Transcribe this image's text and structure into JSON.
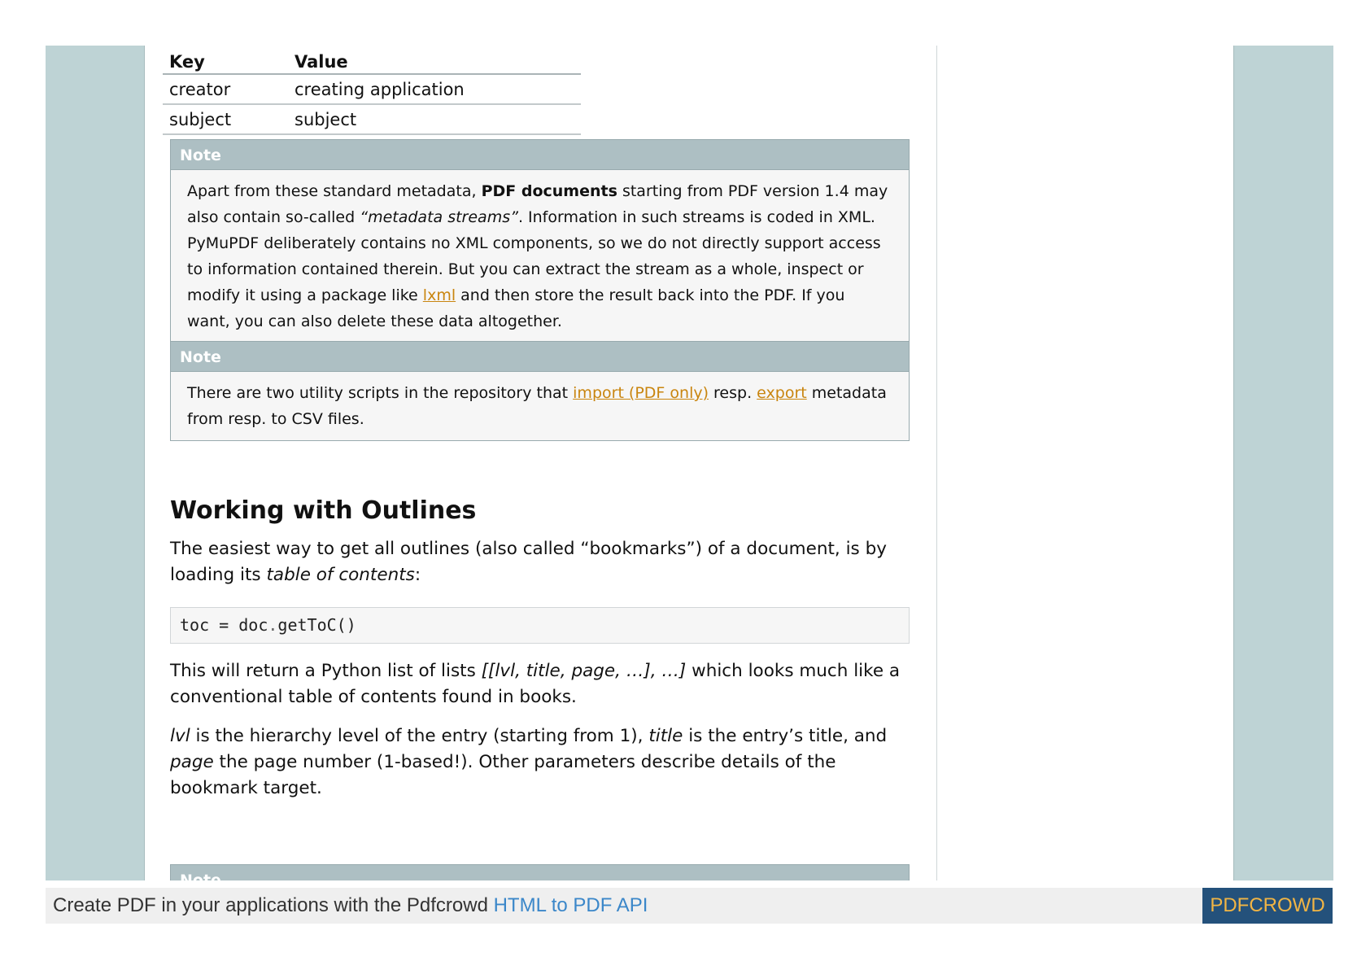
{
  "metadata_table": {
    "headers": [
      "Key",
      "Value"
    ],
    "rows": [
      [
        "creator",
        "creating application"
      ],
      [
        "subject",
        "subject"
      ]
    ]
  },
  "note1": {
    "title": "Note",
    "t1": "Apart from these standard metadata, ",
    "t2": "PDF documents",
    "t3": " starting from PDF version 1.4 may also contain so-called ",
    "t4": "“metadata streams”",
    "t5": ". Information in such streams is coded in XML. PyMuPDF deliberately contains no XML components, so we do not directly support access to information contained therein. But you can extract the stream as a whole, inspect or modify it using a package like ",
    "link": "lxml",
    "t6": " and then store the result back into the PDF. If you want, you can also delete these data altogether."
  },
  "note2": {
    "title": "Note",
    "t1": "There are two utility scripts in the repository that ",
    "link1": "import (PDF only)",
    "t2": " resp. ",
    "link2": "export",
    "t3": " metadata from resp. to CSV files."
  },
  "section": {
    "heading": "Working with Outlines",
    "p1_a": "The easiest way to get all outlines (also called “bookmarks”) of a document, is by loading its ",
    "p1_em": "table of contents",
    "p1_b": ":",
    "code_a": "toc = doc",
    "code_dot": ".",
    "code_b": "getToC()",
    "p2_a": "This will return a Python list of lists ",
    "p2_em": "[[lvl, title, page, …], …]",
    "p2_b": " which looks much like a conventional table of contents found in books.",
    "p3_em1": "lvl",
    "p3_a": " is the hierarchy level of the entry (starting from 1), ",
    "p3_em2": "title",
    "p3_b": " is the entry’s title, and ",
    "p3_em3": "page",
    "p3_c": " the page number (1-based!). Other parameters describe details of the bookmark target."
  },
  "note3": {
    "title": "Note"
  },
  "footer": {
    "text": "Create PDF in your applications with the Pdfcrowd ",
    "link": "HTML to PDF API",
    "badge": "PDFCROWD"
  }
}
